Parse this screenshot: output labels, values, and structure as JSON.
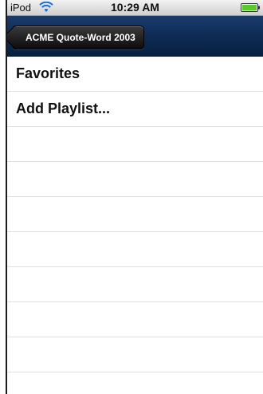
{
  "status_bar": {
    "carrier": "iPod",
    "time": "10:29 AM",
    "wifi_icon": "wifi-icon",
    "battery_icon": "battery-icon",
    "battery_color": "#5ac92b"
  },
  "nav_bar": {
    "back_label": "ACME Quote-Word 2003",
    "color": "#0e2b55"
  },
  "list": {
    "items": [
      {
        "label": "Favorites"
      },
      {
        "label": "Add Playlist..."
      }
    ]
  }
}
